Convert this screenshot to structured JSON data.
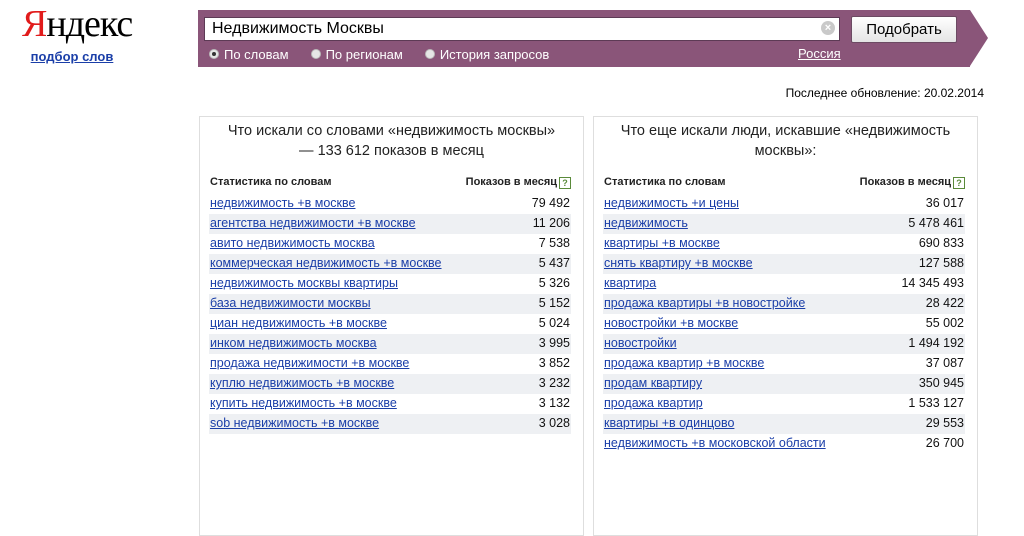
{
  "logo": {
    "first_letter": "Я",
    "rest": "ндекс",
    "subtitle": "подбор слов"
  },
  "search": {
    "query": "Недвижимость Москвы",
    "submit_label": "Подобрать",
    "modes": [
      {
        "label": "По словам",
        "selected": true
      },
      {
        "label": "По регионам",
        "selected": false
      },
      {
        "label": "История запросов",
        "selected": false
      }
    ],
    "region": "Россия"
  },
  "last_update": "Последнее обновление: 20.02.2014",
  "left_panel": {
    "title": "Что искали со словами «недвижимость москвы» — 133 612 показов в месяц",
    "col_keyword": "Статистика по словам",
    "col_count": "Показов в месяц",
    "rows": [
      {
        "keyword": "недвижимость +в москве",
        "count": "79 492"
      },
      {
        "keyword": "агентства недвижимости +в москве",
        "count": "11 206"
      },
      {
        "keyword": "авито недвижимость москва",
        "count": "7 538"
      },
      {
        "keyword": "коммерческая недвижимость +в москве",
        "count": "5 437"
      },
      {
        "keyword": "недвижимость москвы квартиры",
        "count": "5 326"
      },
      {
        "keyword": "база недвижимости москвы",
        "count": "5 152"
      },
      {
        "keyword": "циан недвижимость +в москве",
        "count": "5 024"
      },
      {
        "keyword": "инком недвижимость москва",
        "count": "3 995"
      },
      {
        "keyword": "продажа недвижимости +в москве",
        "count": "3 852"
      },
      {
        "keyword": "куплю недвижимость +в москве",
        "count": "3 232"
      },
      {
        "keyword": "купить недвижимость +в москве",
        "count": "3 132"
      },
      {
        "keyword": "sob недвижимость +в москве",
        "count": "3 028"
      }
    ]
  },
  "right_panel": {
    "title": "Что еще искали люди, искавшие «недвижимость москвы»:",
    "col_keyword": "Статистика по словам",
    "col_count": "Показов в месяц",
    "rows": [
      {
        "keyword": "недвижимость +и цены",
        "count": "36 017"
      },
      {
        "keyword": "недвижимость",
        "count": "5 478 461"
      },
      {
        "keyword": "квартиры +в москве",
        "count": "690 833"
      },
      {
        "keyword": "снять квартиру +в москве",
        "count": "127 588"
      },
      {
        "keyword": "квартира",
        "count": "14 345 493"
      },
      {
        "keyword": "продажа квартиры +в новостройке",
        "count": "28 422"
      },
      {
        "keyword": "новостройки +в москве",
        "count": "55 002"
      },
      {
        "keyword": "новостройки",
        "count": "1 494 192"
      },
      {
        "keyword": "продажа квартир +в москве",
        "count": "37 087"
      },
      {
        "keyword": "продам квартиру",
        "count": "350 945"
      },
      {
        "keyword": "продажа квартир",
        "count": "1 533 127"
      },
      {
        "keyword": "квартиры +в одинцово",
        "count": "29 553"
      },
      {
        "keyword": "недвижимость +в московской области",
        "count": "26 700"
      }
    ]
  }
}
